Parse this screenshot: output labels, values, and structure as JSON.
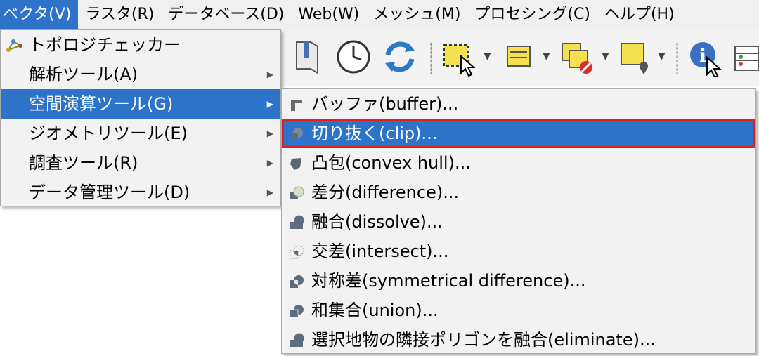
{
  "menubar": {
    "items": [
      {
        "label": "ベクタ(V)",
        "active": true
      },
      {
        "label": "ラスタ(R)"
      },
      {
        "label": "データベース(D)"
      },
      {
        "label": "Web(W)"
      },
      {
        "label": "メッシュ(M)"
      },
      {
        "label": "プロセシング(C)"
      },
      {
        "label": "ヘルプ(H)"
      }
    ]
  },
  "vector_menu": {
    "items": [
      {
        "label": "トポロジチェッカー",
        "icon": "topology-checker-icon",
        "submenu": false
      },
      {
        "label": "解析ツール(A)",
        "submenu": true
      },
      {
        "label": "空間演算ツール(G)",
        "submenu": true,
        "selected": true
      },
      {
        "label": "ジオメトリツール(E)",
        "submenu": true
      },
      {
        "label": "調査ツール(R)",
        "submenu": true
      },
      {
        "label": "データ管理ツール(D)",
        "submenu": true
      }
    ]
  },
  "geoprocessing_menu": {
    "items": [
      {
        "label": "バッファ(buffer)...",
        "icon": "buffer-icon"
      },
      {
        "label": "切り抜く(clip)...",
        "icon": "clip-icon",
        "highlighted": true
      },
      {
        "label": "凸包(convex hull)...",
        "icon": "convex-hull-icon"
      },
      {
        "label": "差分(difference)...",
        "icon": "difference-icon"
      },
      {
        "label": "融合(dissolve)...",
        "icon": "dissolve-icon"
      },
      {
        "label": "交差(intersect)...",
        "icon": "intersect-icon"
      },
      {
        "label": "対称差(symmetrical difference)...",
        "icon": "symmetrical-difference-icon"
      },
      {
        "label": "和集合(union)...",
        "icon": "union-icon"
      },
      {
        "label": "選択地物の隣接ポリゴンを融合(eliminate)...",
        "icon": "eliminate-icon"
      }
    ]
  },
  "colors": {
    "menubar_bg": "#f0f0f0",
    "selection_blue": "#2d73c9",
    "highlight_outline": "#e02020"
  }
}
